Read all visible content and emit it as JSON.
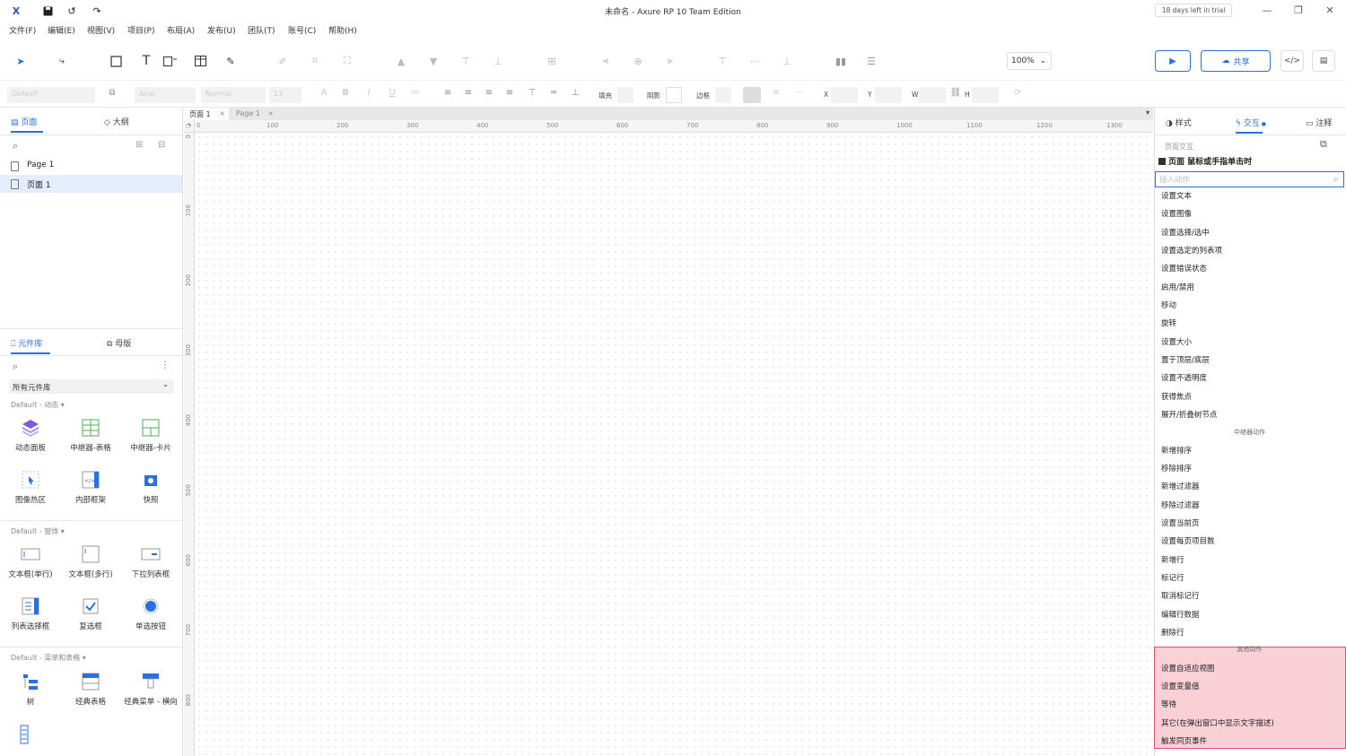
{
  "titlebar": {
    "title": "未命名 - Axure RP 10 Team Edition",
    "trial": "18 days left in trial",
    "app_icon": "X"
  },
  "menu": [
    "文件(F)",
    "编辑(E)",
    "视图(V)",
    "项目(P)",
    "布局(A)",
    "发布(U)",
    "团队(T)",
    "账号(C)",
    "帮助(H)"
  ],
  "toolbar": {
    "zoom": "100%",
    "share_label": "共享"
  },
  "format_bar": {
    "font_style": "Default",
    "font": "Arial",
    "font_weight": "Normal",
    "font_size": "13",
    "fill_label": "填充",
    "shadow_label": "阴影",
    "border_label": "边框",
    "x_label": "X",
    "y_label": "Y",
    "w_label": "W",
    "h_label": "H"
  },
  "left_panel": {
    "tab_pages": "页面",
    "tab_outline": "大纲",
    "pages": [
      "Page 1",
      "页面 1"
    ],
    "tab_library": "元件库",
    "tab_masters": "母版",
    "library_select": "所有元件库",
    "sections": [
      {
        "title": "Default - 动态 ▾",
        "widgets": [
          "动态面板",
          "中继器-表格",
          "中继器-卡片",
          "图像热区",
          "内部框架",
          "快照"
        ]
      },
      {
        "title": "Default - 窗体 ▾",
        "widgets": [
          "文本框(单行)",
          "文本框(多行)",
          "下拉列表框",
          "列表选择框",
          "复选框",
          "单选按钮"
        ]
      },
      {
        "title": "Default - 菜单和表格 ▾",
        "widgets": [
          "树",
          "经典表格",
          "经典菜单 - 横向"
        ]
      }
    ]
  },
  "canvas": {
    "tabs": [
      "页面 1",
      "Page 1"
    ],
    "hruler": [
      "0",
      "100",
      "200",
      "300",
      "400",
      "500",
      "600",
      "700",
      "800",
      "900",
      "1000",
      "1100",
      "1200",
      "1300"
    ],
    "vruler": [
      "0",
      "100",
      "200",
      "300",
      "400",
      "500",
      "600",
      "700",
      "800"
    ]
  },
  "right_panel": {
    "tab_style": "样式",
    "tab_interaction": "交互",
    "tab_notes": "注释",
    "section_label": "页面交互",
    "event": "页面 鼠标或手指单击时",
    "search_placeholder": "插入动作",
    "actions_general": [
      "设置文本",
      "设置图像",
      "设置选择/选中",
      "设置选定的列表项",
      "设置错误状态",
      "启用/禁用",
      "移动",
      "旋转",
      "设置大小",
      "置于顶层/底层",
      "设置不透明度",
      "获得焦点",
      "展开/折叠树节点"
    ],
    "group_repeater": "中继器动作",
    "actions_repeater": [
      "新增排序",
      "移除排序",
      "新增过滤器",
      "移除过滤器",
      "设置当前页",
      "设置每页项目数",
      "新增行",
      "标记行",
      "取消标记行",
      "编辑行数据",
      "删除行"
    ],
    "group_other": "其他动作",
    "actions_other": [
      "设置自适应视图",
      "设置变量值",
      "等待",
      "其它(在弹出窗口中显示文字描述)",
      "触发同页事件"
    ]
  }
}
